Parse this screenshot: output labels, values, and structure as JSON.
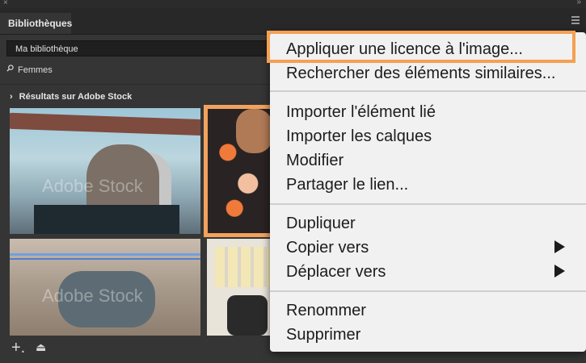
{
  "window": {
    "tab_label": "Bibliothèques",
    "close_glyph": "×",
    "collapse_glyph": "»"
  },
  "library": {
    "selected": "Ma bibliothèque"
  },
  "search": {
    "value": "Femmes"
  },
  "results": {
    "label": "Résultats sur Adobe Stock"
  },
  "watermark": "Adobe Stock",
  "bottom": {
    "add_glyph": "+.",
    "upload_glyph": "⏏"
  },
  "context_menu": {
    "items": [
      "Appliquer une licence à l'image...",
      "Rechercher des éléments similaires...",
      "Importer l'élément lié",
      "Importer les calques",
      "Modifier",
      "Partager le lien...",
      "Dupliquer",
      "Copier vers",
      "Déplacer vers",
      "Renommer",
      "Supprimer"
    ],
    "highlight_color": "#f5a052"
  }
}
